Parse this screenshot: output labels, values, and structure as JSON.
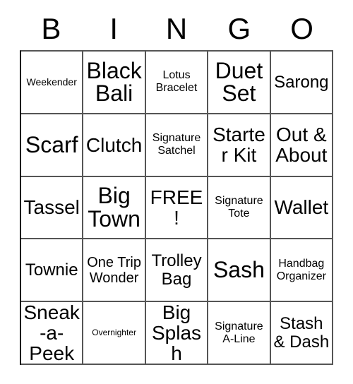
{
  "card": {
    "title": "BINGO",
    "columns": [
      "B",
      "I",
      "N",
      "G",
      "O"
    ],
    "free_space_label": "FREE!",
    "border_color": "#555555",
    "text_color": "#000000",
    "background_color": "#ffffff",
    "rows": [
      [
        {
          "label": "Weekender",
          "size": "fs-xs"
        },
        {
          "label": "Black Bali",
          "size": "fs-xxl"
        },
        {
          "label": "Lotus Bracelet",
          "size": "fs-s"
        },
        {
          "label": "Duet Set",
          "size": "fs-xxl"
        },
        {
          "label": "Sarong",
          "size": "fs-l"
        }
      ],
      [
        {
          "label": "Scarf",
          "size": "fs-xxl"
        },
        {
          "label": "Clutch",
          "size": "fs-xl"
        },
        {
          "label": "Signature Satchel",
          "size": "fs-s"
        },
        {
          "label": "Starter Kit",
          "size": "fs-xl"
        },
        {
          "label": "Out & About",
          "size": "fs-xl"
        }
      ],
      [
        {
          "label": "Tassel",
          "size": "fs-xl"
        },
        {
          "label": "Big Town",
          "size": "fs-xxl"
        },
        {
          "label": "FREE!",
          "size": "fs-xl"
        },
        {
          "label": "Signature Tote",
          "size": "fs-s"
        },
        {
          "label": "Wallet",
          "size": "fs-xl"
        }
      ],
      [
        {
          "label": "Townie",
          "size": "fs-l"
        },
        {
          "label": "One Trip Wonder",
          "size": "fs-m"
        },
        {
          "label": "Trolley Bag",
          "size": "fs-l"
        },
        {
          "label": "Sash",
          "size": "fs-xxl"
        },
        {
          "label": "Handbag Organizer",
          "size": "fs-s"
        }
      ],
      [
        {
          "label": "Sneak-a-Peek",
          "size": "fs-xl"
        },
        {
          "label": "Overnighter",
          "size": "fs-xxs"
        },
        {
          "label": "Big Splash",
          "size": "fs-xl"
        },
        {
          "label": "Signature A-Line",
          "size": "fs-s"
        },
        {
          "label": "Stash & Dash",
          "size": "fs-l"
        }
      ]
    ]
  }
}
